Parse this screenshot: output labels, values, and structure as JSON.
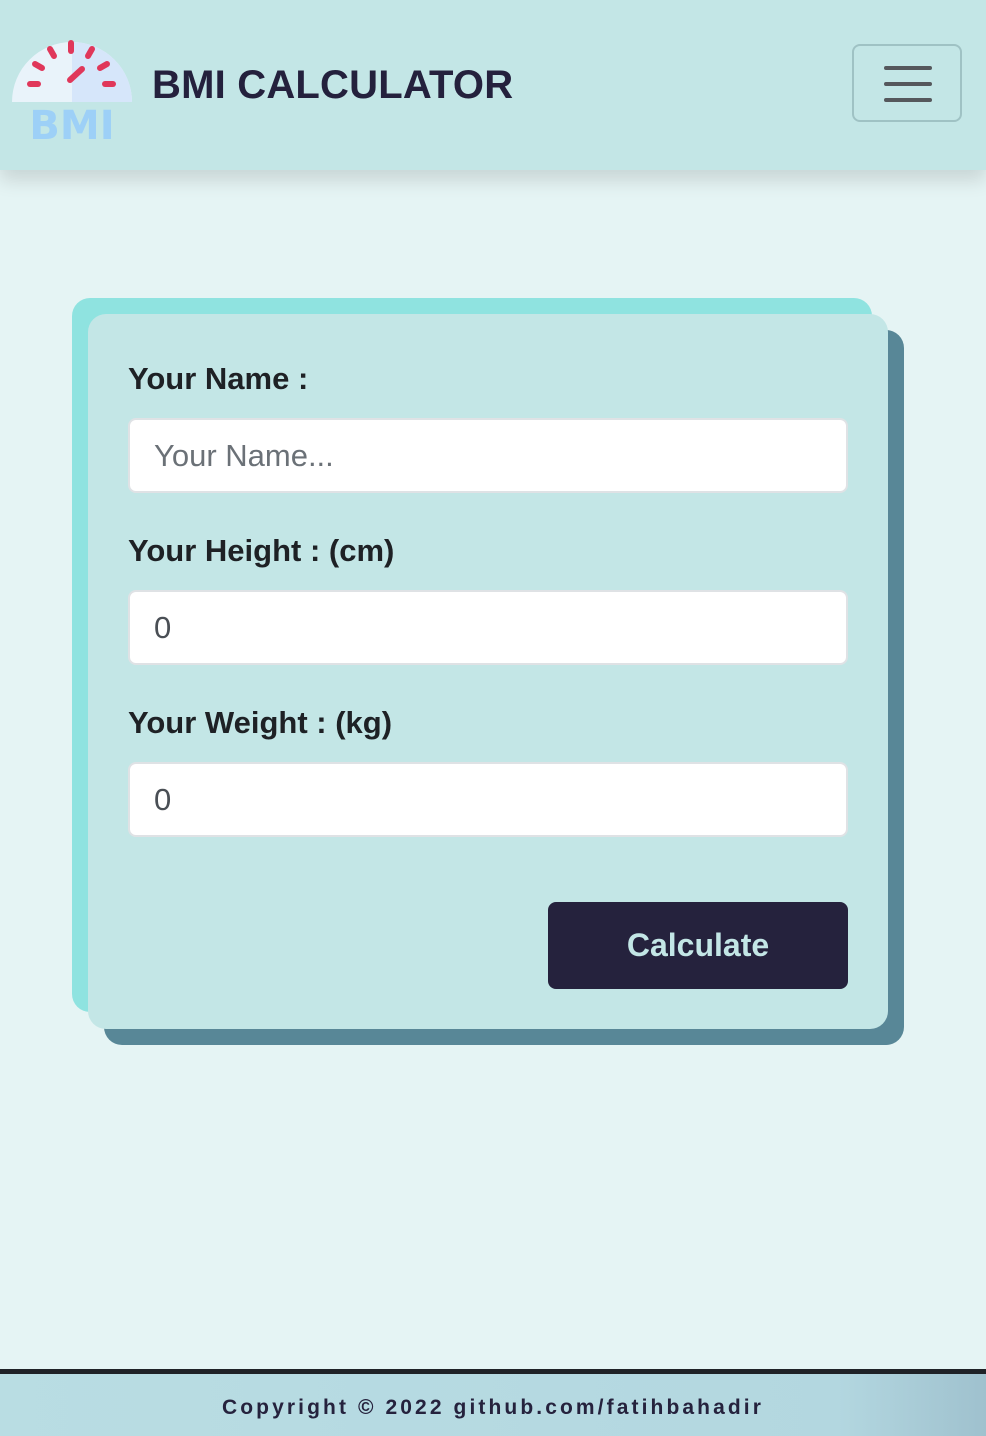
{
  "navbar": {
    "logo_text": "BMI",
    "title": "BMI CALCULATOR",
    "menu_icon": "hamburger-menu-icon"
  },
  "form": {
    "name_label": "Your Name :",
    "name_placeholder": "Your Name...",
    "name_value": "",
    "height_label": "Your Height : (cm)",
    "height_value": "0",
    "weight_label": "Your Weight : (kg)",
    "weight_value": "0",
    "calculate_label": "Calculate"
  },
  "footer": {
    "text": "Copyright © 2022 github.com/fatihbahadir"
  },
  "colors": {
    "navbar_bg": "#c3e6e6",
    "page_bg": "#e5f4f4",
    "card_bg": "#c3e6e6",
    "card_accent_teal": "#8fe3e0",
    "card_accent_slate": "#588797",
    "button_bg": "#25223d",
    "title_color": "#24213d",
    "logo_tick_color": "#e0375a",
    "logo_text_color": "#9dd0f7"
  }
}
